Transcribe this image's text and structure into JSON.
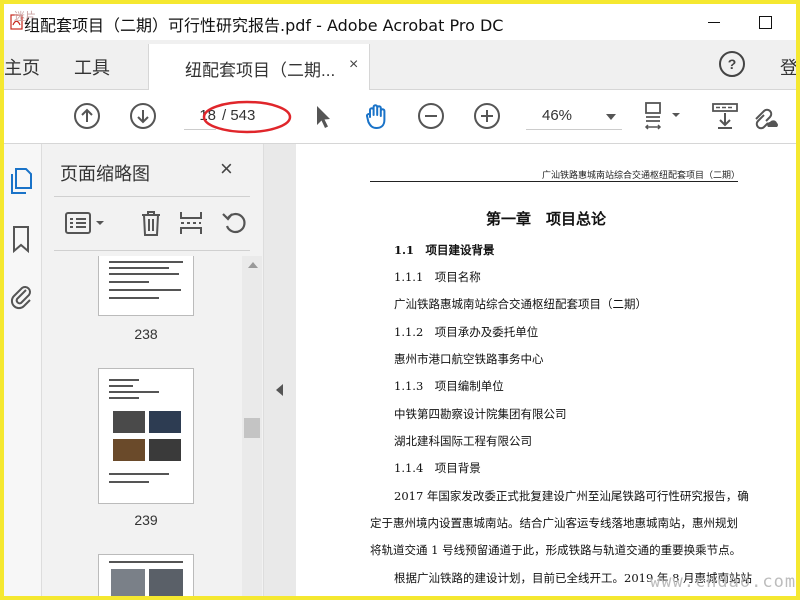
{
  "window": {
    "title": "组配套项目（二期）可行性研究报告.pdf - Adobe Acrobat Pro DC",
    "corner_stamp": "迷片"
  },
  "tabs": {
    "home": "主页",
    "tools": "工具",
    "document": "纽配套项目（二期...",
    "close": "×",
    "login": "登"
  },
  "toolbar": {
    "current_page": "18",
    "total_pages": "/ 543",
    "zoom": "46%",
    "annotation_color": "#e0262b",
    "active_tool_color": "#1a73c8"
  },
  "thumbnails": {
    "title": "页面缩略图",
    "close": "×",
    "pages": [
      "238",
      "239"
    ]
  },
  "document": {
    "header": "广汕铁路惠城南站综合交通枢纽配套项目（二期）",
    "chapter": "第一章　项目总论",
    "lines": [
      "1.1　项目建设背景",
      "1.1.1　项目名称",
      "广汕铁路惠城南站综合交通枢纽配套项目（二期）",
      "1.1.2　项目承办及委托单位",
      "惠州市港口航空铁路事务中心",
      "1.1.3　项目编制单位",
      "中铁第四勘察设计院集团有限公司",
      "湖北建科国际工程有限公司",
      "1.1.4　项目背景",
      "2017 年国家发改委正式批复建设广州至汕尾铁路可行性研究报告，确",
      "定于惠州境内设置惠城南站。结合广汕客运专线落地惠城南站，惠州规划",
      "将轨道交通 1 号线预留通道于此，形成铁路与轨道交通的重要换乘节点。",
      "根据广汕铁路的建设计划，目前已全线开工。2019 年 8 月惠城南站站"
    ]
  },
  "watermark": "www.cndao.com"
}
